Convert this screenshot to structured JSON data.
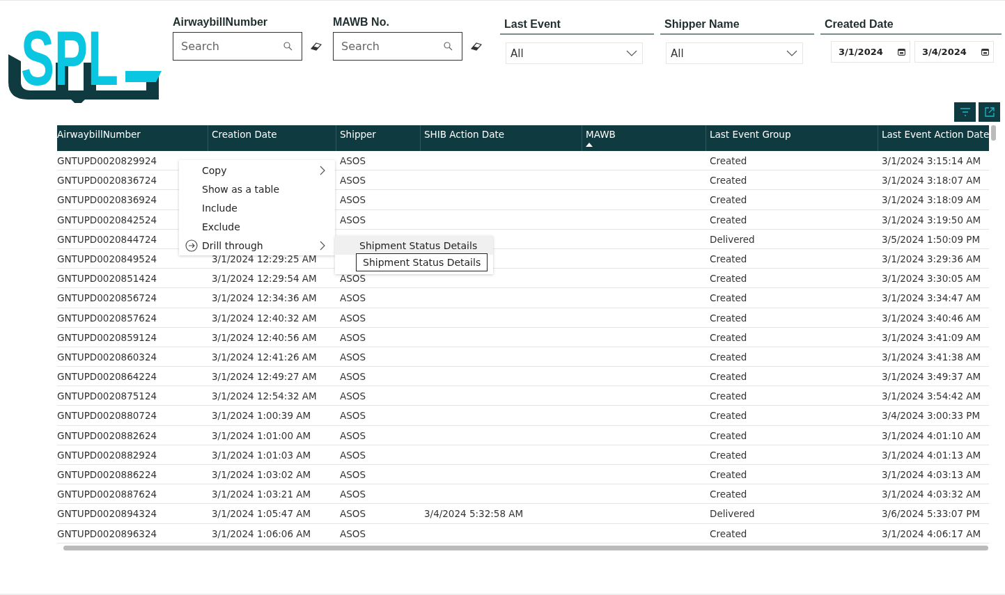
{
  "logo": {
    "text": "SPL"
  },
  "search_filters": [
    {
      "label": "AirwaybillNumber",
      "placeholder": "Search"
    },
    {
      "label": "MAWB No.",
      "placeholder": "Search"
    }
  ],
  "dropdown_filters": [
    {
      "label": "Last Event",
      "value": "All"
    },
    {
      "label": "Shipper Name",
      "value": "All"
    }
  ],
  "date_filter": {
    "label": "Created Date",
    "from": "3/1/2024",
    "to": "3/4/2024"
  },
  "table": {
    "columns": [
      {
        "label": "AirwaybillNumber",
        "sorted": false
      },
      {
        "label": "Creation Date",
        "sorted": false
      },
      {
        "label": "Shipper",
        "sorted": false
      },
      {
        "label": "SHIB Action Date",
        "sorted": false
      },
      {
        "label": "MAWB",
        "sorted": true
      },
      {
        "label": "Last Event Group",
        "sorted": false
      },
      {
        "label": "Last Event Action Date",
        "sorted": false
      }
    ],
    "rows": [
      {
        "awb": "GNTUPD0020829924",
        "shipper": "ASOS",
        "group": "Created",
        "last": "3/1/2024 3:15:14 AM"
      },
      {
        "awb": "GNTUPD0020836724",
        "shipper": "ASOS",
        "group": "Created",
        "last": "3/1/2024 3:18:07 AM"
      },
      {
        "awb": "GNTUPD0020836924",
        "shipper": "ASOS",
        "group": "Created",
        "last": "3/1/2024 3:18:09 AM"
      },
      {
        "awb": "GNTUPD0020842524",
        "shipper": "ASOS",
        "group": "Created",
        "last": "3/1/2024 3:19:50 AM"
      },
      {
        "awb": "GNTUPD0020844724",
        "group": "Delivered",
        "last": "3/5/2024 1:50:09 PM"
      },
      {
        "awb": "GNTUPD0020849524",
        "created": "3/1/2024 12:29:25 AM",
        "group": "Created",
        "last": "3/1/2024 3:29:36 AM"
      },
      {
        "awb": "GNTUPD0020851424",
        "created": "3/1/2024 12:29:54 AM",
        "shipper": "ASOS",
        "group": "Created",
        "last": "3/1/2024 3:30:05 AM"
      },
      {
        "awb": "GNTUPD0020856724",
        "created": "3/1/2024 12:34:36 AM",
        "shipper": "ASOS",
        "group": "Created",
        "last": "3/1/2024 3:34:47 AM"
      },
      {
        "awb": "GNTUPD0020857624",
        "created": "3/1/2024 12:40:32 AM",
        "shipper": "ASOS",
        "group": "Created",
        "last": "3/1/2024 3:40:46 AM"
      },
      {
        "awb": "GNTUPD0020859124",
        "created": "3/1/2024 12:40:56 AM",
        "shipper": "ASOS",
        "group": "Created",
        "last": "3/1/2024 3:41:09 AM"
      },
      {
        "awb": "GNTUPD0020860324",
        "created": "3/1/2024 12:41:26 AM",
        "shipper": "ASOS",
        "group": "Created",
        "last": "3/1/2024 3:41:38 AM"
      },
      {
        "awb": "GNTUPD0020864224",
        "created": "3/1/2024 12:49:27 AM",
        "shipper": "ASOS",
        "group": "Created",
        "last": "3/1/2024 3:49:37 AM"
      },
      {
        "awb": "GNTUPD0020875124",
        "created": "3/1/2024 12:54:32 AM",
        "shipper": "ASOS",
        "group": "Created",
        "last": "3/1/2024 3:54:42 AM"
      },
      {
        "awb": "GNTUPD0020880724",
        "created": "3/1/2024 1:00:39 AM",
        "shipper": "ASOS",
        "group": "Created",
        "last": "3/4/2024 3:00:33 PM"
      },
      {
        "awb": "GNTUPD0020882624",
        "created": "3/1/2024 1:01:00 AM",
        "shipper": "ASOS",
        "group": "Created",
        "last": "3/1/2024 4:01:10 AM"
      },
      {
        "awb": "GNTUPD0020882924",
        "created": "3/1/2024 1:01:03 AM",
        "shipper": "ASOS",
        "group": "Created",
        "last": "3/1/2024 4:01:13 AM"
      },
      {
        "awb": "GNTUPD0020886224",
        "created": "3/1/2024 1:03:02 AM",
        "shipper": "ASOS",
        "group": "Created",
        "last": "3/1/2024 4:03:13 AM"
      },
      {
        "awb": "GNTUPD0020887624",
        "created": "3/1/2024 1:03:21 AM",
        "shipper": "ASOS",
        "group": "Created",
        "last": "3/1/2024 4:03:32 AM"
      },
      {
        "awb": "GNTUPD0020894324",
        "created": "3/1/2024 1:05:47 AM",
        "shipper": "ASOS",
        "shib": "3/4/2024 5:32:58 AM",
        "group": "Delivered",
        "last": "3/6/2024 5:33:07 PM"
      },
      {
        "awb": "GNTUPD0020896324",
        "created": "3/1/2024 1:06:06 AM",
        "shipper": "ASOS",
        "group": "Created",
        "last": "3/1/2024 4:06:17 AM"
      }
    ]
  },
  "context_menu": {
    "items": [
      {
        "label": "Copy",
        "submenu": true,
        "kind": "plain"
      },
      {
        "label": "Show as a table",
        "submenu": false,
        "kind": "plain"
      },
      {
        "label": "Include",
        "submenu": false,
        "kind": "plain"
      },
      {
        "label": "Exclude",
        "submenu": false,
        "kind": "plain"
      },
      {
        "label": "Drill through",
        "submenu": true,
        "kind": "drill"
      }
    ],
    "submenu_items": [
      "Shipment Status Details"
    ],
    "tooltip": "Shipment Status Details"
  }
}
